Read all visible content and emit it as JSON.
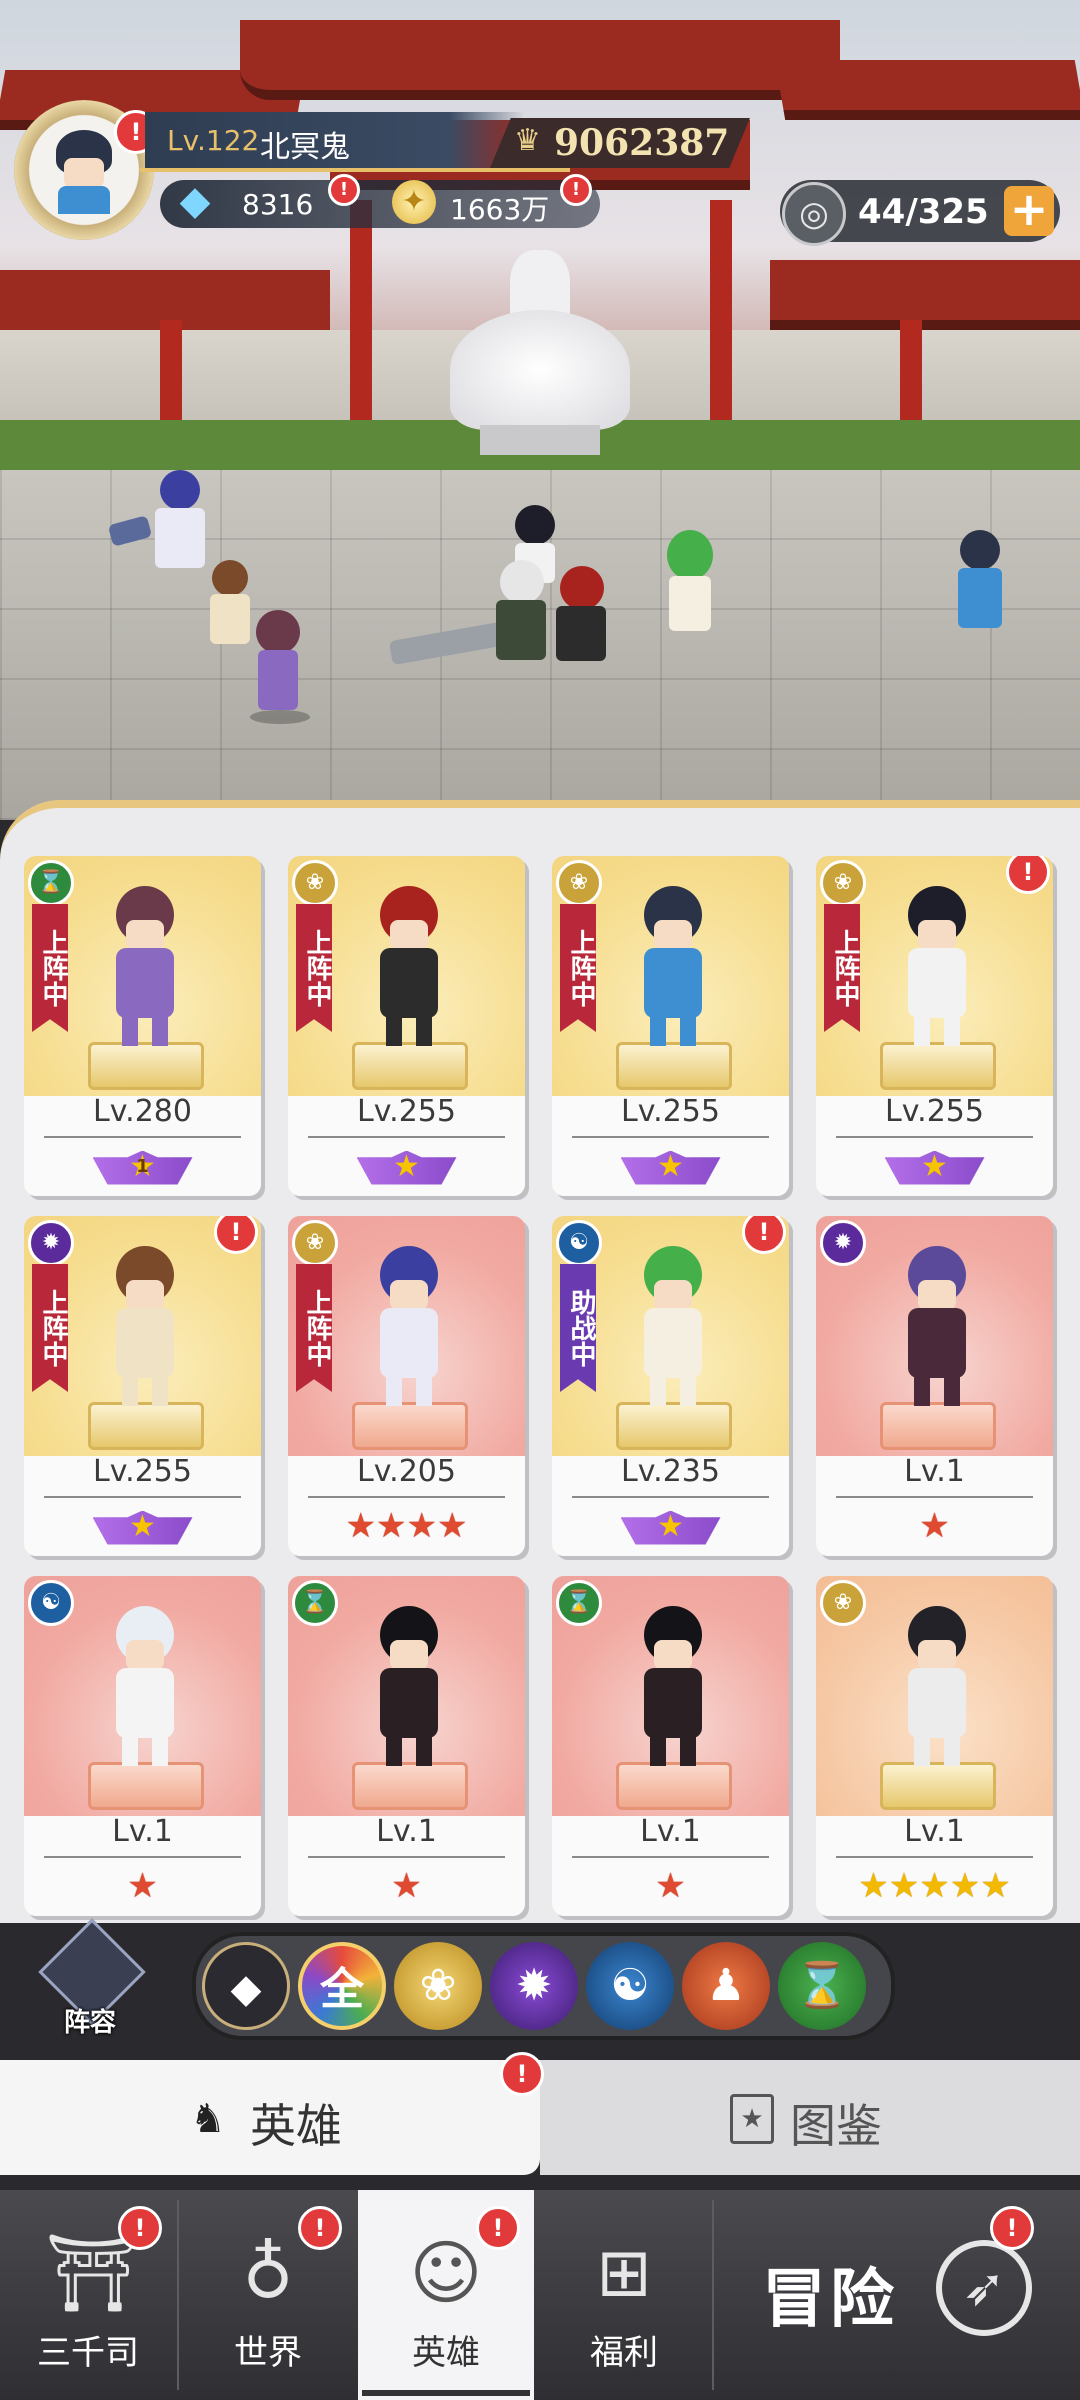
{
  "player": {
    "level": "Lv.122",
    "name": "北冥鬼",
    "power": "9062387",
    "diamonds": "8316",
    "coins": "1663万",
    "stamina": "44/325"
  },
  "colors": {
    "gold_card": "#f6dd8f",
    "red_card": "#f1a9a1",
    "orange_card": "#f6c8a4",
    "tag_red": "#b9283a",
    "tag_purple": "#6a3ab0",
    "alert": "#e23a3a",
    "faction_green": "#2e8b3e",
    "faction_lotus": "#c9a33a",
    "faction_fire": "#5b2a9b",
    "faction_spiral": "#1d5fa0"
  },
  "heroes": [
    {
      "level": "Lv.280",
      "faction": "dna-icon",
      "status": "上阵中",
      "stars": "winged-1",
      "alert": false,
      "bg": "gold"
    },
    {
      "level": "Lv.255",
      "faction": "lotus-icon",
      "status": "上阵中",
      "stars": "winged",
      "alert": false,
      "bg": "gold"
    },
    {
      "level": "Lv.255",
      "faction": "lotus-icon",
      "status": "上阵中",
      "stars": "winged",
      "alert": false,
      "bg": "gold"
    },
    {
      "level": "Lv.255",
      "faction": "lotus-icon",
      "status": "上阵中",
      "stars": "winged",
      "alert": true,
      "bg": "gold"
    },
    {
      "level": "Lv.255",
      "faction": "flame-icon",
      "status": "上阵中",
      "stars": "winged",
      "alert": true,
      "bg": "gold"
    },
    {
      "level": "Lv.205",
      "faction": "lotus-icon",
      "status": "上阵中",
      "stars": "4-red",
      "alert": false,
      "bg": "red"
    },
    {
      "level": "Lv.235",
      "faction": "spiral-icon",
      "status": "助战中",
      "stars": "winged",
      "alert": true,
      "bg": "gold"
    },
    {
      "level": "Lv.1",
      "faction": "flame-icon",
      "status": "",
      "stars": "1-red",
      "alert": false,
      "bg": "red"
    },
    {
      "level": "Lv.1",
      "faction": "spiral-icon",
      "status": "",
      "stars": "1-red",
      "alert": false,
      "bg": "red"
    },
    {
      "level": "Lv.1",
      "faction": "dna-icon",
      "status": "",
      "stars": "1-red",
      "alert": false,
      "bg": "red"
    },
    {
      "level": "Lv.1",
      "faction": "dna-icon",
      "status": "",
      "stars": "1-red",
      "alert": false,
      "bg": "red"
    },
    {
      "level": "Lv.1",
      "faction": "lotus-icon",
      "status": "",
      "stars": "5-gold",
      "alert": false,
      "bg": "orange"
    }
  ],
  "winged_star_number": "1",
  "filters": {
    "lineup_label": "阵容",
    "all_label": "全",
    "items": [
      "diamond-icon",
      "all",
      "lotus-icon",
      "flame-icon",
      "spiral-icon",
      "meditation-icon",
      "dna-icon"
    ]
  },
  "tabs": {
    "hero": "英雄",
    "album": "图鉴"
  },
  "nav": {
    "items": [
      "三千司",
      "世界",
      "英雄",
      "福利"
    ],
    "adventure": "冒险"
  }
}
